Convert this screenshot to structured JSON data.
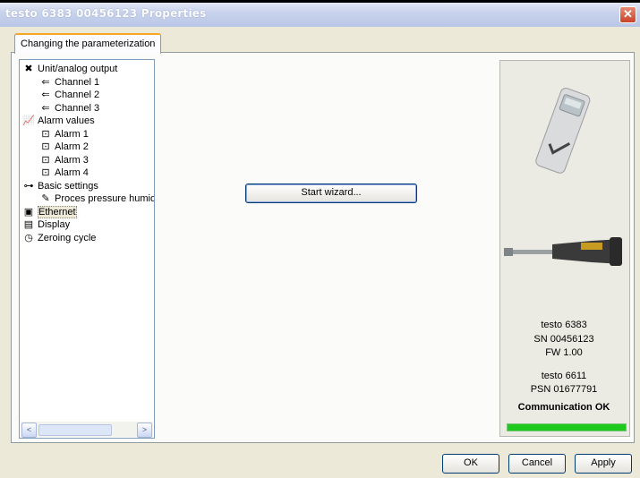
{
  "window": {
    "title": "testo 6383  00456123 Properties",
    "close_glyph": "✕"
  },
  "tab": {
    "label": "Changing the parameterization"
  },
  "tree": {
    "items": [
      {
        "label": "Unit/analog output",
        "icon": "tools-icon",
        "glyph": "✖"
      },
      {
        "label": "Channel 1",
        "icon": "plug-icon",
        "glyph": "⇐"
      },
      {
        "label": "Channel 2",
        "icon": "plug-icon",
        "glyph": "⇐"
      },
      {
        "label": "Channel 3",
        "icon": "plug-icon",
        "glyph": "⇐"
      },
      {
        "label": "Alarm values",
        "icon": "chart-icon",
        "glyph": "📈"
      },
      {
        "label": "Alarm 1",
        "icon": "alarm-icon",
        "glyph": "⊡"
      },
      {
        "label": "Alarm 2",
        "icon": "alarm-icon",
        "glyph": "⊡"
      },
      {
        "label": "Alarm 3",
        "icon": "alarm-icon",
        "glyph": "⊡"
      },
      {
        "label": "Alarm 4",
        "icon": "alarm-icon",
        "glyph": "⊡"
      },
      {
        "label": "Basic settings",
        "icon": "settings-icon",
        "glyph": "⊶"
      },
      {
        "label": "Proces pressure humidity",
        "icon": "gauge-icon",
        "glyph": "✎"
      },
      {
        "label": "Ethernet",
        "icon": "network-icon",
        "glyph": "▣"
      },
      {
        "label": "Display",
        "icon": "display-icon",
        "glyph": "▤"
      },
      {
        "label": "Zeroing cycle",
        "icon": "clock-icon",
        "glyph": "◷"
      }
    ],
    "scroll_left": "<",
    "scroll_right": ">"
  },
  "main": {
    "wizard_label": "Start wizard..."
  },
  "info": {
    "model": "testo 6383",
    "serial": "SN 00456123",
    "firmware": "FW  1.00",
    "probe_model": "testo 6611",
    "probe_serial": "PSN 01677791",
    "status": "Communication OK",
    "status_progress": 1.0,
    "status_color": "#1ec91e"
  },
  "buttons": {
    "ok": "OK",
    "cancel": "Cancel",
    "apply": "Apply"
  }
}
